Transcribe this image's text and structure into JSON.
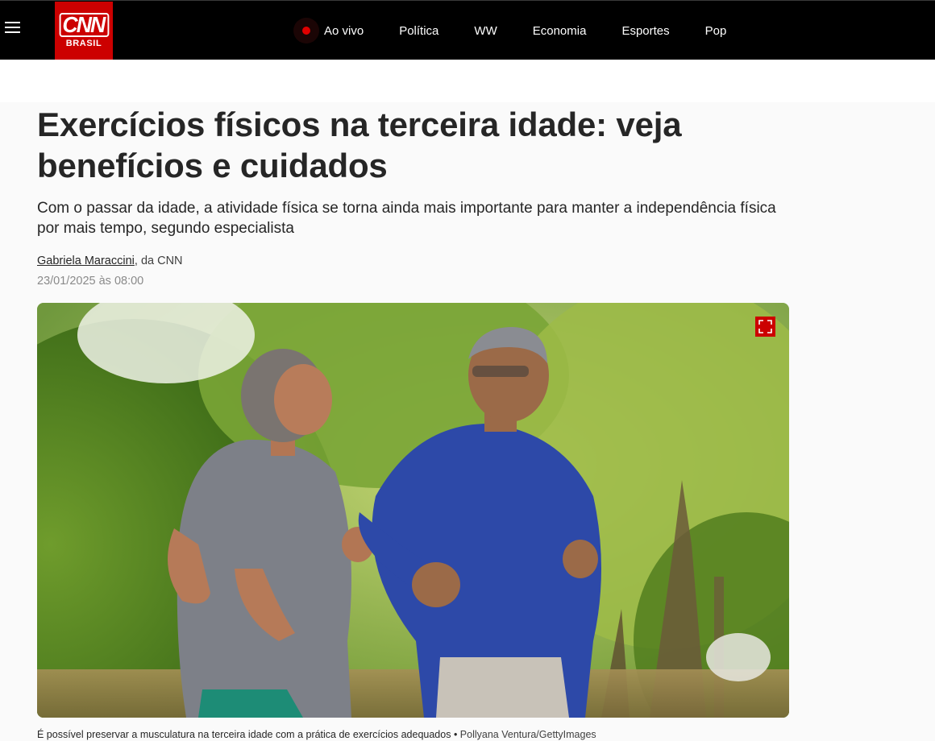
{
  "nav": {
    "brand_main": "CNN",
    "brand_sub": "BRASIL",
    "links": [
      "Ao vivo",
      "Política",
      "WW",
      "Economia",
      "Esportes",
      "Pop"
    ]
  },
  "article": {
    "title": "Exercícios físicos na terceira idade: veja benefícios e cuidados",
    "subtitle": "Com o passar da idade, a atividade física se torna ainda mais importante para manter a independência física por mais tempo, segundo especialista",
    "author": "Gabriela Maraccini",
    "author_suffix": ", da CNN",
    "date": "23/01/2025 às 08:00",
    "image": {
      "caption": "É possível preservar a musculatura na terceira idade com a prática de exercícios adequados",
      "separator": " • ",
      "credit": "Pollyana Ventura/GettyImages"
    }
  },
  "icons": {
    "menu": "hamburger-menu-icon",
    "live": "live-dot-icon",
    "expand": "expand-fullscreen-icon"
  },
  "colors": {
    "brand_red": "#cc0000",
    "nav_bg": "#000000",
    "live_red": "#e00000"
  }
}
